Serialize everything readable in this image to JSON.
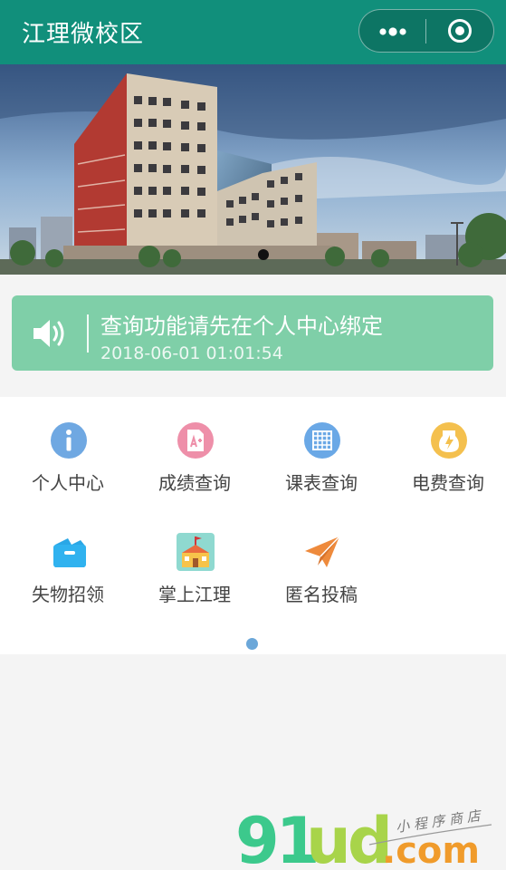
{
  "nav": {
    "title": "江理微校区"
  },
  "notice": {
    "text": "查询功能请先在个人中心绑定",
    "time": "2018-06-01 01:01:54"
  },
  "grid": {
    "items": [
      {
        "label": "个人中心",
        "icon": "info-icon",
        "color": "#6fa8e2"
      },
      {
        "label": "成绩查询",
        "icon": "grade-report-icon",
        "color": "#ee8fa9"
      },
      {
        "label": "课表查询",
        "icon": "timetable-grid-icon",
        "color": "#6aa8e6"
      },
      {
        "label": "电费查询",
        "icon": "electricity-bolt-icon",
        "color": "#f4c04e"
      },
      {
        "label": "失物招领",
        "icon": "lost-box-icon",
        "color": "#2aa7e6"
      },
      {
        "label": "掌上江理",
        "icon": "campus-school-icon",
        "color": "#f7c34a"
      },
      {
        "label": "匿名投稿",
        "icon": "paper-plane-icon",
        "color": "#ee8a3c"
      }
    ]
  },
  "watermark": {
    "logo": "91ud.com",
    "tagline": "小程序商店"
  },
  "colors": {
    "nav": "#118f7b",
    "notice": "#7fcfa8",
    "pageDot": "#6ba7d9"
  }
}
